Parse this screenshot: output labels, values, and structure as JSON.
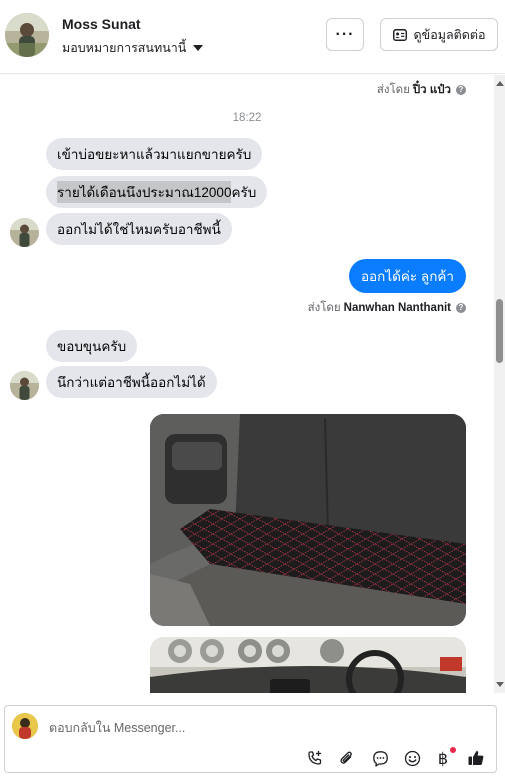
{
  "header": {
    "name": "Moss Sunat",
    "assign_label": "มอบหมายการสนทนานี้",
    "more_label": "···",
    "contact_label": "ดูข้อมูลติดต่อ"
  },
  "thread": {
    "top_sent_by_prefix": "ส่งโดย",
    "top_sent_by_name": "ปิ๋ว แป๋ว",
    "timestamp": "18:22",
    "msg1": "เข้าบ่อขยะหาแล้วมาแยกขายครับ",
    "msg2_highlight": "รายได้เดือนนึงประมาณ12000",
    "msg2_rest": "ครับ",
    "msg3": "ออกไม่ได้ใช่ไหมครับอาชีพนี้",
    "reply": "ออกได้ค่ะ ลูกค้า",
    "reply_sent_by_prefix": "ส่งโดย",
    "reply_sent_by_name": "Nanwhan Nanthanit",
    "msg4": "ขอบขุนครับ",
    "msg5": "นึกว่าแต่อาชีพนี้ออกไม่ได้",
    "info_glyph": "?"
  },
  "composer": {
    "placeholder": "ตอบกลับใน Messenger...",
    "baht_symbol": "฿"
  },
  "colors": {
    "accent": "#0a7cff",
    "incoming_bubble": "#e4e6eb",
    "notification_dot": "#f02849"
  }
}
